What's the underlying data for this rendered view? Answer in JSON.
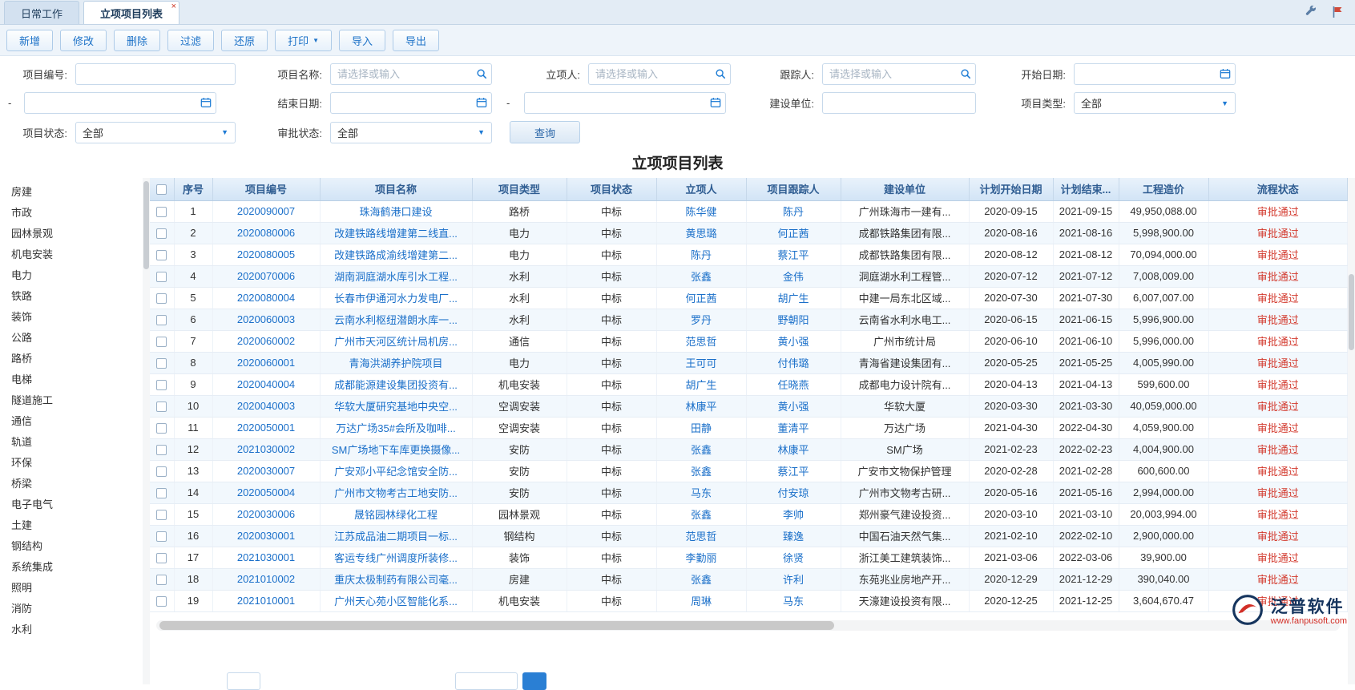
{
  "window": {
    "tabs": [
      {
        "id": "daily-work",
        "label": "日常工作",
        "active": false
      },
      {
        "id": "project-list",
        "label": "立项项目列表",
        "active": true,
        "close_glyph": "×"
      }
    ]
  },
  "toolbar": {
    "buttons": [
      {
        "id": "add",
        "label": "新增"
      },
      {
        "id": "edit",
        "label": "修改"
      },
      {
        "id": "delete",
        "label": "删除"
      },
      {
        "id": "filter",
        "label": "过滤"
      },
      {
        "id": "restore",
        "label": "还原"
      },
      {
        "id": "print",
        "label": "打印",
        "dropdown": true
      },
      {
        "id": "import",
        "label": "导入"
      },
      {
        "id": "export",
        "label": "导出"
      }
    ]
  },
  "search": {
    "labels": {
      "project_code": "项目编号:",
      "project_name": "项目名称:",
      "creator": "立项人:",
      "tracker": "跟踪人:",
      "start_date": "开始日期:",
      "range_dash": "-",
      "end_date": "结束日期:",
      "build_unit": "建设单位:",
      "project_type": "项目类型:",
      "project_status": "项目状态:",
      "approval_status": "审批状态:"
    },
    "placeholders": {
      "select_or_input": "请选择或输入"
    },
    "selects": {
      "project_type": "全部",
      "project_status": "全部",
      "approval_status": "全部"
    },
    "query_button": "查询"
  },
  "page": {
    "title": "立项项目列表"
  },
  "sidebar": {
    "items": [
      "房建",
      "市政",
      "园林景观",
      "机电安装",
      "电力",
      "铁路",
      "装饰",
      "公路",
      "路桥",
      "电梯",
      "隧道施工",
      "通信",
      "轨道",
      "环保",
      "桥梁",
      "电子电气",
      "土建",
      "钢结构",
      "系统集成",
      "照明",
      "消防",
      "水利"
    ]
  },
  "table": {
    "columns": [
      "序号",
      "项目编号",
      "项目名称",
      "项目类型",
      "项目状态",
      "立项人",
      "项目跟踪人",
      "建设单位",
      "计划开始日期",
      "计划结束...",
      "工程造价",
      "流程状态"
    ],
    "rows": [
      {
        "seq": "1",
        "code": "2020090007",
        "name": "珠海鹤港口建设",
        "type": "路桥",
        "status": "中标",
        "creator": "陈华健",
        "tracker": "陈丹",
        "unit": "广州珠海市一建有...",
        "start": "2020-09-15",
        "end": "2021-09-15",
        "cost": "49,950,088.00",
        "flow": "审批通过"
      },
      {
        "seq": "2",
        "code": "2020080006",
        "name": "改建铁路线增建第二线直...",
        "type": "电力",
        "status": "中标",
        "creator": "黄思璐",
        "tracker": "何正茜",
        "unit": "成都铁路集团有限...",
        "start": "2020-08-16",
        "end": "2021-08-16",
        "cost": "5,998,900.00",
        "flow": "审批通过"
      },
      {
        "seq": "3",
        "code": "2020080005",
        "name": "改建铁路成渝线增建第二...",
        "type": "电力",
        "status": "中标",
        "creator": "陈丹",
        "tracker": "蔡江平",
        "unit": "成都铁路集团有限...",
        "start": "2020-08-12",
        "end": "2021-08-12",
        "cost": "70,094,000.00",
        "flow": "审批通过"
      },
      {
        "seq": "4",
        "code": "2020070006",
        "name": "湖南洞庭湖水库引水工程...",
        "type": "水利",
        "status": "中标",
        "creator": "张鑫",
        "tracker": "金伟",
        "unit": "洞庭湖水利工程管...",
        "start": "2020-07-12",
        "end": "2021-07-12",
        "cost": "7,008,009.00",
        "flow": "审批通过"
      },
      {
        "seq": "5",
        "code": "2020080004",
        "name": "长春市伊通河水力发电厂...",
        "type": "水利",
        "status": "中标",
        "creator": "何正茜",
        "tracker": "胡广生",
        "unit": "中建一局东北区域...",
        "start": "2020-07-30",
        "end": "2021-07-30",
        "cost": "6,007,007.00",
        "flow": "审批通过"
      },
      {
        "seq": "6",
        "code": "2020060003",
        "name": "云南水利枢纽潜朗水库一...",
        "type": "水利",
        "status": "中标",
        "creator": "罗丹",
        "tracker": "野朝阳",
        "unit": "云南省水利水电工...",
        "start": "2020-06-15",
        "end": "2021-06-15",
        "cost": "5,996,900.00",
        "flow": "审批通过"
      },
      {
        "seq": "7",
        "code": "2020060002",
        "name": "广州市天河区统计局机房...",
        "type": "通信",
        "status": "中标",
        "creator": "范思哲",
        "tracker": "黄小强",
        "unit": "广州市统计局",
        "start": "2020-06-10",
        "end": "2021-06-10",
        "cost": "5,996,000.00",
        "flow": "审批通过"
      },
      {
        "seq": "8",
        "code": "2020060001",
        "name": "青海洪湖养护院项目",
        "type": "电力",
        "status": "中标",
        "creator": "王可可",
        "tracker": "付伟璐",
        "unit": "青海省建设集团有...",
        "start": "2020-05-25",
        "end": "2021-05-25",
        "cost": "4,005,990.00",
        "flow": "审批通过"
      },
      {
        "seq": "9",
        "code": "2020040004",
        "name": "成都能源建设集团投资有...",
        "type": "机电安装",
        "status": "中标",
        "creator": "胡广生",
        "tracker": "任晓燕",
        "unit": "成都电力设计院有...",
        "start": "2020-04-13",
        "end": "2021-04-13",
        "cost": "599,600.00",
        "flow": "审批通过"
      },
      {
        "seq": "10",
        "code": "2020040003",
        "name": "华软大厦研究基地中央空...",
        "type": "空调安装",
        "status": "中标",
        "creator": "林康平",
        "tracker": "黄小强",
        "unit": "华软大厦",
        "start": "2020-03-30",
        "end": "2021-03-30",
        "cost": "40,059,000.00",
        "flow": "审批通过"
      },
      {
        "seq": "11",
        "code": "2020050001",
        "name": "万达广场35#会所及咖啡...",
        "type": "空调安装",
        "status": "中标",
        "creator": "田静",
        "tracker": "董清平",
        "unit": "万达广场",
        "start": "2021-04-30",
        "end": "2022-04-30",
        "cost": "4,059,900.00",
        "flow": "审批通过"
      },
      {
        "seq": "12",
        "code": "2021030002",
        "name": "SM广场地下车库更换摄像...",
        "type": "安防",
        "status": "中标",
        "creator": "张鑫",
        "tracker": "林康平",
        "unit": "SM广场",
        "start": "2021-02-23",
        "end": "2022-02-23",
        "cost": "4,004,900.00",
        "flow": "审批通过"
      },
      {
        "seq": "13",
        "code": "2020030007",
        "name": "广安邓小平纪念馆安全防...",
        "type": "安防",
        "status": "中标",
        "creator": "张鑫",
        "tracker": "蔡江平",
        "unit": "广安市文物保护管理",
        "start": "2020-02-28",
        "end": "2021-02-28",
        "cost": "600,600.00",
        "flow": "审批通过"
      },
      {
        "seq": "14",
        "code": "2020050004",
        "name": "广州市文物考古工地安防...",
        "type": "安防",
        "status": "中标",
        "creator": "马东",
        "tracker": "付安琼",
        "unit": "广州市文物考古研...",
        "start": "2020-05-16",
        "end": "2021-05-16",
        "cost": "2,994,000.00",
        "flow": "审批通过"
      },
      {
        "seq": "15",
        "code": "2020030006",
        "name": "晟铭园林绿化工程",
        "type": "园林景观",
        "status": "中标",
        "creator": "张鑫",
        "tracker": "李帅",
        "unit": "郑州豪气建设投资...",
        "start": "2020-03-10",
        "end": "2021-03-10",
        "cost": "20,003,994.00",
        "flow": "审批通过"
      },
      {
        "seq": "16",
        "code": "2020030001",
        "name": "江苏成品油二期项目一标...",
        "type": "钢结构",
        "status": "中标",
        "creator": "范思哲",
        "tracker": "臻逸",
        "unit": "中国石油天然气集...",
        "start": "2021-02-10",
        "end": "2022-02-10",
        "cost": "2,900,000.00",
        "flow": "审批通过"
      },
      {
        "seq": "17",
        "code": "2021030001",
        "name": "客运专线广州调度所装修...",
        "type": "装饰",
        "status": "中标",
        "creator": "李勤丽",
        "tracker": "徐贤",
        "unit": "浙江美工建筑装饰...",
        "start": "2021-03-06",
        "end": "2022-03-06",
        "cost": "39,900.00",
        "flow": "审批通过"
      },
      {
        "seq": "18",
        "code": "2021010002",
        "name": "重庆太极制药有限公司毫...",
        "type": "房建",
        "status": "中标",
        "creator": "张鑫",
        "tracker": "许利",
        "unit": "东苑兆业房地产开...",
        "start": "2020-12-29",
        "end": "2021-12-29",
        "cost": "390,040.00",
        "flow": "审批通过"
      },
      {
        "seq": "19",
        "code": "2021010001",
        "name": "广州天心苑小区智能化系...",
        "type": "机电安装",
        "status": "中标",
        "creator": "周琳",
        "tracker": "马东",
        "unit": "天濠建设投资有限...",
        "start": "2020-12-25",
        "end": "2021-12-25",
        "cost": "3,604,670.47",
        "flow": "审批通过"
      }
    ]
  },
  "footer_logo": {
    "brand": "泛普软件",
    "site": "www.fanpusoft.com"
  }
}
